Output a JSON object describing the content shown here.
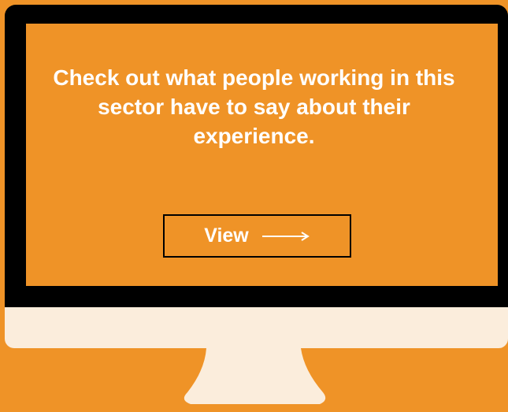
{
  "colors": {
    "background": "#ef9327",
    "bezel": "#000000",
    "screen": "#ef9327",
    "chin": "#fbeddc",
    "stand": "#fbeddc",
    "text": "#ffffff"
  },
  "monitor": {
    "headline": "Check out what people working in this sector have to say about their experience.",
    "cta": {
      "label": "View",
      "icon": "long-arrow-right-icon"
    }
  }
}
